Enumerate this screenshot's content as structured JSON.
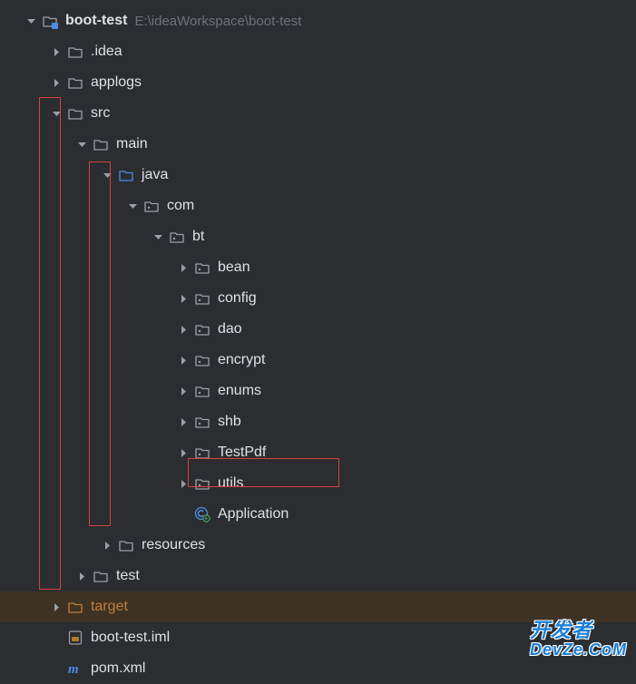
{
  "root": {
    "name": "boot-test",
    "path": "E:\\ideaWorkspace\\boot-test"
  },
  "items": {
    "idea": ".idea",
    "applogs": "applogs",
    "src": "src",
    "main": "main",
    "java": "java",
    "com": "com",
    "bt": "bt",
    "bean": "bean",
    "config": "config",
    "dao": "dao",
    "encrypt": "encrypt",
    "enums": "enums",
    "shb": "shb",
    "testpdf": "TestPdf",
    "utils": "utils",
    "application": "Application",
    "resources": "resources",
    "test": "test",
    "target": "target",
    "iml": "boot-test.iml",
    "pom": "pom.xml"
  },
  "watermark": {
    "line1": "开发者",
    "line2": "DevZe.CoM"
  },
  "icons": {
    "chevron_right": "chevron-right",
    "chevron_down": "chevron-down",
    "folder": "folder",
    "folder_blue": "folder-source",
    "package": "package",
    "class": "class",
    "iml": "iml",
    "pom": "maven"
  }
}
